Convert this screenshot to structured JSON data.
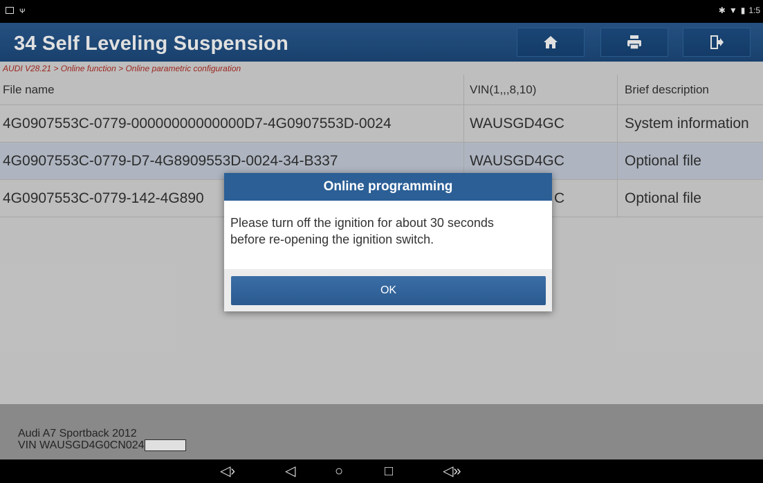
{
  "status_bar": {
    "time": "1:5"
  },
  "header": {
    "title": "34 Self Leveling Suspension"
  },
  "breadcrumb": "AUDI V28.21 > Online function > Online parametric configuration",
  "table": {
    "columns": [
      "File name",
      "VIN(1,,,8,10)",
      "Brief description"
    ],
    "rows": [
      {
        "file_name": "4G0907553C-0779-00000000000000D7-4G0907553D-0024",
        "vin": "WAUSGD4GC",
        "description": "System information"
      },
      {
        "file_name": "4G0907553C-0779-D7-4G8909553D-0024-34-B337",
        "vin": "WAUSGD4GC",
        "description": "Optional file"
      },
      {
        "file_name": "4G0907553C-0779-142-4G890",
        "vin": "C",
        "description": "Optional file"
      }
    ]
  },
  "footer": {
    "vehicle": "Audi A7 Sportback 2012",
    "vin": "VIN WAUSGD4G0CN024"
  },
  "dialog": {
    "title": "Online programming",
    "message_line1": "Please turn off the ignition for about 30 seconds",
    "message_line2": "before re-opening the ignition switch.",
    "ok_label": "OK"
  },
  "icons": {
    "home": "home-icon",
    "print": "printer-icon",
    "exit": "exit-icon",
    "nav": [
      "volume-down-icon",
      "back-icon",
      "home-circle-icon",
      "recent-apps-icon",
      "volume-up-icon"
    ]
  },
  "colors": {
    "title_bar": "#2a5c92",
    "breadcrumb_text": "#b02a20",
    "selected_row": "#c6cfdb",
    "ok_button": "#2f6299"
  }
}
